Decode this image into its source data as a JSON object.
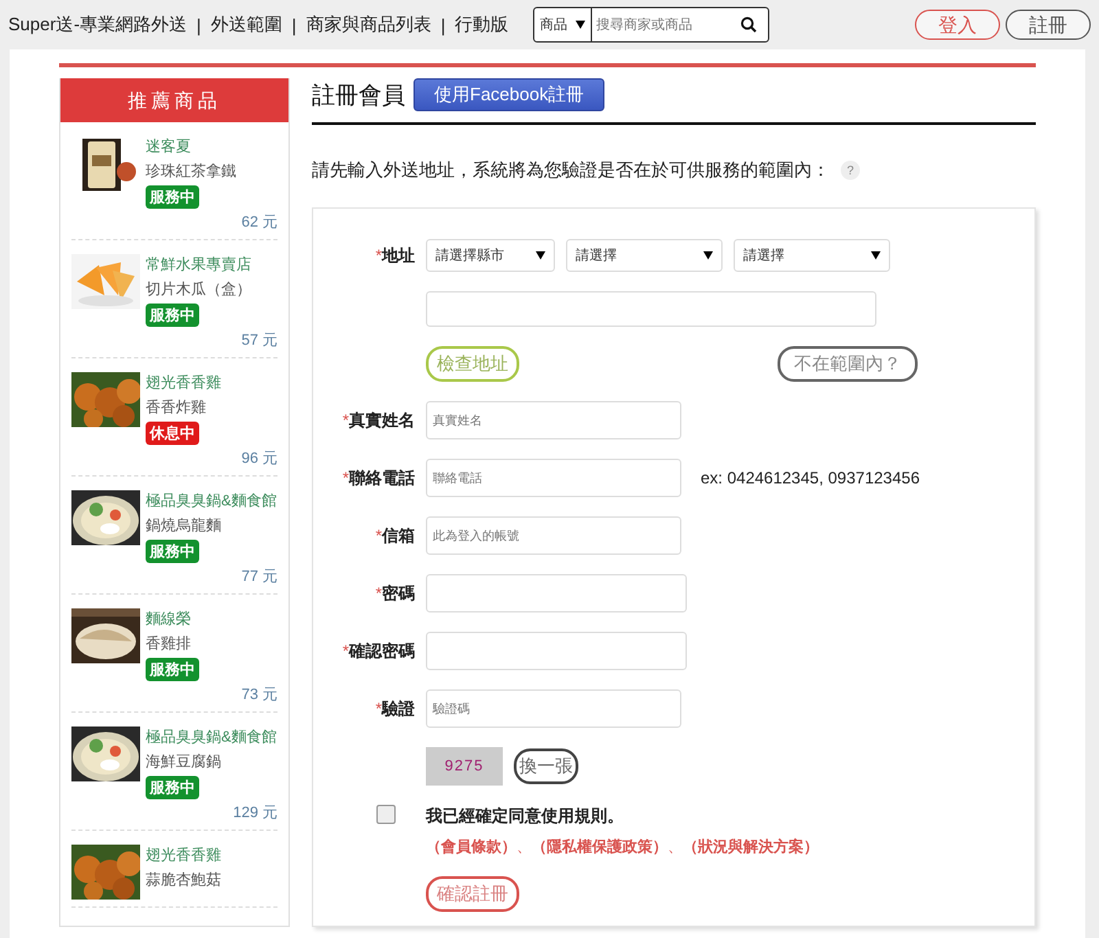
{
  "top_nav": {
    "links": [
      "Super送-專業網路外送",
      "外送範圍",
      "商家與商品列表",
      "行動版"
    ],
    "separator": "|",
    "search": {
      "category": "商品",
      "placeholder": "搜尋商家或商品"
    },
    "buttons": [
      {
        "label": "登入",
        "kind": "primary"
      },
      {
        "label": "註冊",
        "kind": "secondary"
      }
    ]
  },
  "sidebar": {
    "title": "推薦商品",
    "items": [
      {
        "store": "迷客夏",
        "product": "珍珠紅茶拿鐵",
        "status": "服務中",
        "open": true,
        "price": "62 元"
      },
      {
        "store": "常鮮水果專賣店",
        "product": "切片木瓜（盒）",
        "status": "服務中",
        "open": true,
        "price": "57 元"
      },
      {
        "store": "翅光香香雞",
        "product": "香香炸雞",
        "status": "休息中",
        "open": false,
        "price": "96 元"
      },
      {
        "store": "極品臭臭鍋&麵食館",
        "product": "鍋燒烏龍麵",
        "status": "服務中",
        "open": true,
        "price": "77 元"
      },
      {
        "store": "麵線榮",
        "product": "香雞排",
        "status": "服務中",
        "open": true,
        "price": "73 元"
      },
      {
        "store": "極品臭臭鍋&麵食館",
        "product": "海鮮豆腐鍋",
        "status": "服務中",
        "open": true,
        "price": "129 元"
      },
      {
        "store": "翅光香香雞",
        "product": "蒜脆杏鮑菇"
      }
    ]
  },
  "main": {
    "title": "註冊會員",
    "facebook_button": "使用Facebook註冊",
    "intro": "請先輸入外送地址，系統將為您驗證是否在於可供服務的範圍內：",
    "help": "?",
    "address": {
      "label": "地址",
      "selects": [
        "請選擇縣市",
        "請選擇",
        "請選擇"
      ],
      "check_button": "檢查地址",
      "out_of_range_button": "不在範圍內？"
    },
    "fields": [
      {
        "label": "真實姓名",
        "placeholder": "真實姓名"
      },
      {
        "label": "聯絡電話",
        "placeholder": "聯絡電話",
        "hint": "ex: 0424612345, 0937123456"
      },
      {
        "label": "信箱",
        "placeholder": "此為登入的帳號"
      },
      {
        "label": "密碼"
      },
      {
        "label": "確認密碼"
      },
      {
        "label": "驗證",
        "placeholder": "驗證碼"
      }
    ],
    "required_mark": "*",
    "captcha": {
      "text": "9275",
      "refresh_button": "換一張"
    },
    "agree": {
      "checked": false,
      "label": "我已經確定同意使用規則。",
      "links": [
        "（會員條款）",
        "（隱私權保護政策）",
        "（狀況與解決方案）"
      ],
      "link_separator": "、"
    },
    "submit_button": "確認註冊"
  }
}
